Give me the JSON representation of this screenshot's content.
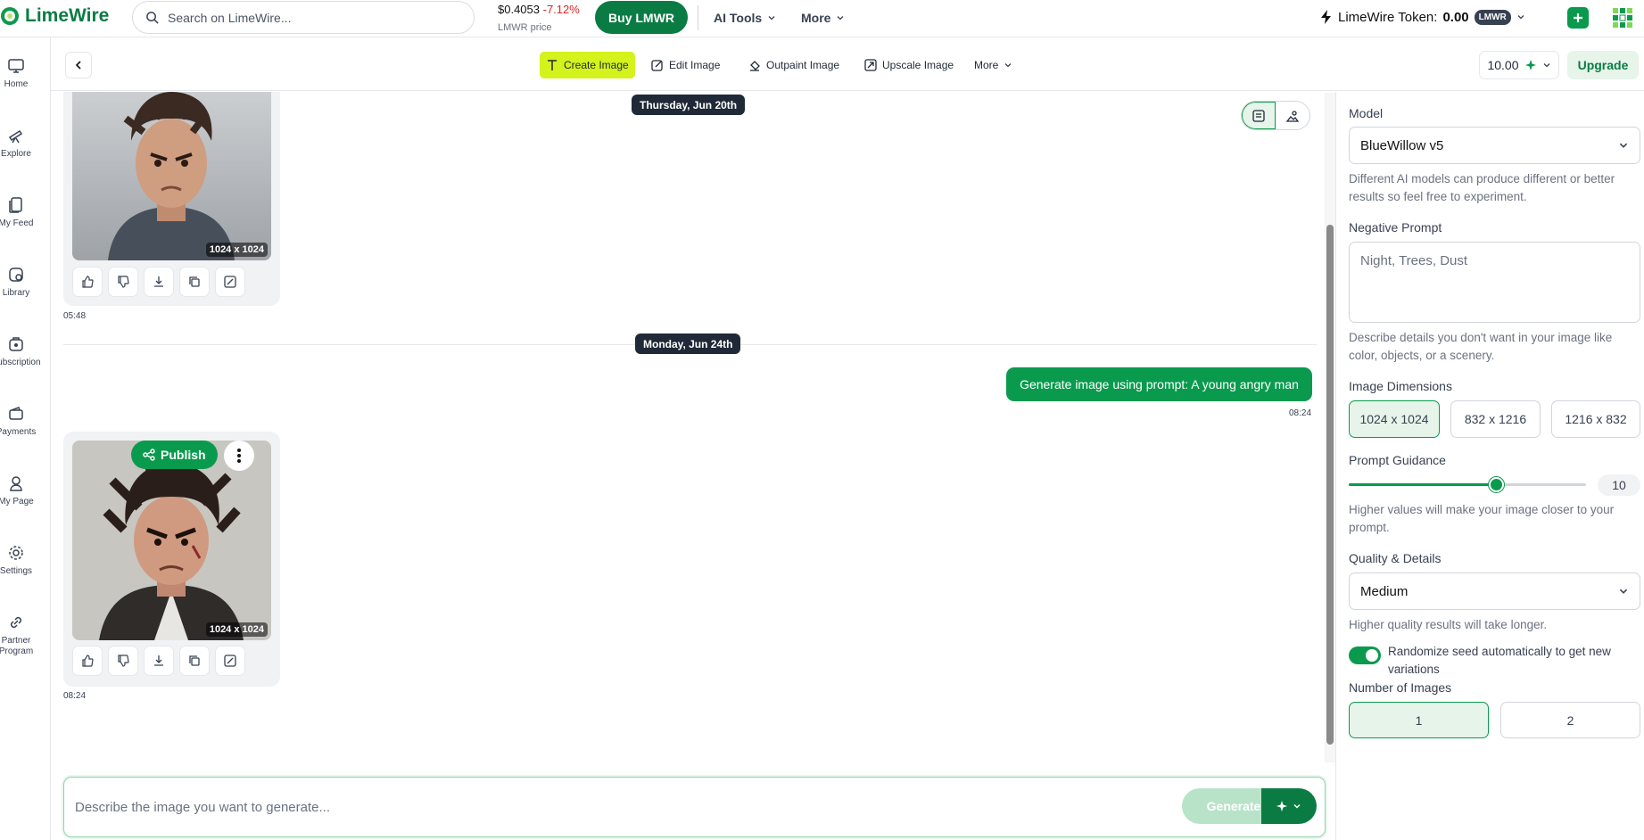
{
  "app": {
    "name": "LimeWire"
  },
  "search": {
    "placeholder": "Search on LimeWire..."
  },
  "price": {
    "value": "$0.4053",
    "change": "-7.12%",
    "label": "LMWR price"
  },
  "buy_label": "Buy LMWR",
  "top_menu": [
    {
      "label": "AI Tools"
    },
    {
      "label": "More"
    }
  ],
  "token": {
    "label": "LimeWire Token:",
    "amount": "0.00",
    "symbol": "LMWR"
  },
  "sidebar": {
    "items": [
      {
        "label": "Home",
        "icon": "monitor-icon"
      },
      {
        "label": "Explore",
        "icon": "telescope-icon"
      },
      {
        "label": "My Feed",
        "icon": "feed-icon"
      },
      {
        "label": "Library",
        "icon": "library-icon"
      },
      {
        "label": "Subscription",
        "icon": "subscription-icon"
      },
      {
        "label": "Payments",
        "icon": "wallet-icon"
      },
      {
        "label": "My Page",
        "icon": "user-icon"
      },
      {
        "label": "Settings",
        "icon": "gear-icon"
      },
      {
        "label": "Partner Program",
        "icon": "link-icon"
      }
    ]
  },
  "tools": {
    "create": "Create Image",
    "edit": "Edit Image",
    "outpaint": "Outpaint Image",
    "upscale": "Upscale Image",
    "more": "More"
  },
  "credits": "10.00",
  "upgrade_label": "Upgrade",
  "chat": {
    "dates": [
      "Thursday, Jun 20th",
      "Monday, Jun 24th"
    ],
    "image1": {
      "size": "1024 x 1024",
      "time": "05:48"
    },
    "prompt": {
      "text": "Generate image using prompt: A young angry man",
      "time": "08:24"
    },
    "image2": {
      "size": "1024 x 1024",
      "time": "08:24",
      "publish": "Publish"
    }
  },
  "composer": {
    "placeholder": "Describe the image you want to generate...",
    "generate": "Generate"
  },
  "panel": {
    "model_label": "Model",
    "model_value": "BlueWillow v5",
    "model_help": "Different AI models can produce different or better results so feel free to experiment.",
    "neg_label": "Negative Prompt",
    "neg_placeholder": "Night, Trees, Dust",
    "neg_help": "Describe details you don't want in your image like color, objects, or a scenery.",
    "dim_label": "Image Dimensions",
    "dims": [
      {
        "label": "1024 x 1024",
        "selected": true
      },
      {
        "label": "832 x 1216",
        "selected": false
      },
      {
        "label": "1216 x 832",
        "selected": false
      }
    ],
    "guidance_label": "Prompt Guidance",
    "guidance_value": "10",
    "guidance_fraction": 0.62,
    "guidance_help": "Higher values will make your image closer to your prompt.",
    "quality_label": "Quality & Details",
    "quality_value": "Medium",
    "quality_help": "Higher quality results will take longer.",
    "seed_label": "Randomize seed automatically to get new variations",
    "seed_on": true,
    "num_label": "Number of Images",
    "nums": [
      {
        "label": "1",
        "selected": true
      },
      {
        "label": "2",
        "selected": false
      }
    ]
  },
  "colors": {
    "brand": "#0a7c43",
    "accent": "#0a9a4e",
    "active_tool": "#d4f21c",
    "negative": "#dc2626"
  }
}
